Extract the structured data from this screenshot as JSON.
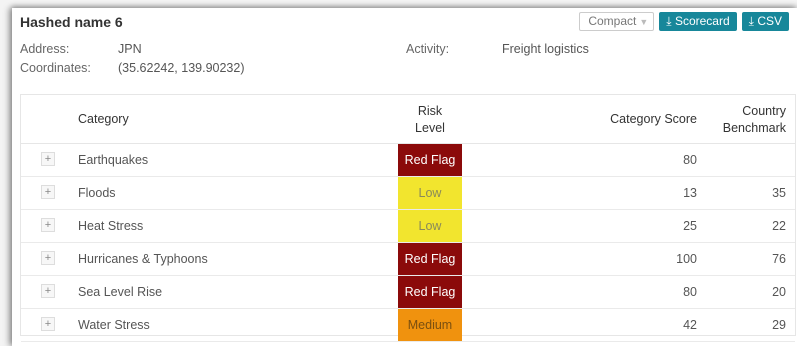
{
  "header": {
    "title": "Hashed name 6",
    "compact_label": "Compact",
    "scorecard_label": "Scorecard",
    "csv_label": "CSV"
  },
  "meta": {
    "address_label": "Address:",
    "address_value": "JPN",
    "coordinates_label": "Coordinates:",
    "coordinates_value": "(35.62242, 139.90232)",
    "activity_label": "Activity:",
    "activity_value": "Freight logistics"
  },
  "table": {
    "columns": {
      "category": "Category",
      "risk_line1": "Risk",
      "risk_line2": "Level",
      "score": "Category Score",
      "bench_line1": "Country",
      "bench_line2": "Benchmark"
    },
    "rows": [
      {
        "category": "Earthquakes",
        "risk": "Red Flag",
        "score": "80",
        "benchmark": ""
      },
      {
        "category": "Floods",
        "risk": "Low",
        "score": "13",
        "benchmark": "35"
      },
      {
        "category": "Heat Stress",
        "risk": "Low",
        "score": "25",
        "benchmark": "22"
      },
      {
        "category": "Hurricanes & Typhoons",
        "risk": "Red Flag",
        "score": "100",
        "benchmark": "76"
      },
      {
        "category": "Sea Level Rise",
        "risk": "Red Flag",
        "score": "80",
        "benchmark": "20"
      },
      {
        "category": "Water Stress",
        "risk": "Medium",
        "score": "42",
        "benchmark": "29"
      }
    ]
  },
  "risk_colors": {
    "Red Flag": {
      "bg": "#8b0a0a",
      "fg": "#ffffff"
    },
    "Low": {
      "bg": "#f2e52e",
      "fg": "#8a8a5a"
    },
    "Medium": {
      "bg": "#f0920e",
      "fg": "#7a4f10"
    }
  },
  "accent_color": "#17879a"
}
